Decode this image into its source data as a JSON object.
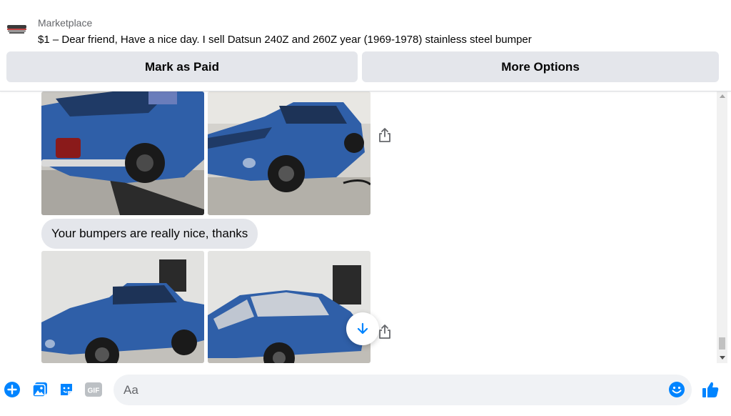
{
  "header": {
    "section": "Marketplace",
    "listing_title": "$1 – Dear friend, Have a nice day. I sell Datsun 240Z and 260Z year (1969-1978) stainless steel bumper",
    "mark_paid_label": "Mark as Paid",
    "more_options_label": "More Options"
  },
  "conversation": {
    "received_message": "Your bumpers are really nice, thanks",
    "photos": [
      {
        "subject": "blue Datsun rear view"
      },
      {
        "subject": "blue Datsun front view"
      },
      {
        "subject": "blue Datsun side view"
      },
      {
        "subject": "blue Datsun side view 2"
      }
    ]
  },
  "composer": {
    "placeholder": "Aa",
    "icons": [
      "plus-circle-icon",
      "photo-icon",
      "sticker-icon",
      "gif-icon",
      "emoji-icon",
      "thumbs-up-icon"
    ],
    "gif_label": "GIF"
  },
  "colors": {
    "accent": "#0084ff",
    "button_bg": "#e4e6eb",
    "bubble_bg": "#e4e6eb",
    "input_bg": "#f0f2f5",
    "car_blue": "#2f5fa8"
  }
}
